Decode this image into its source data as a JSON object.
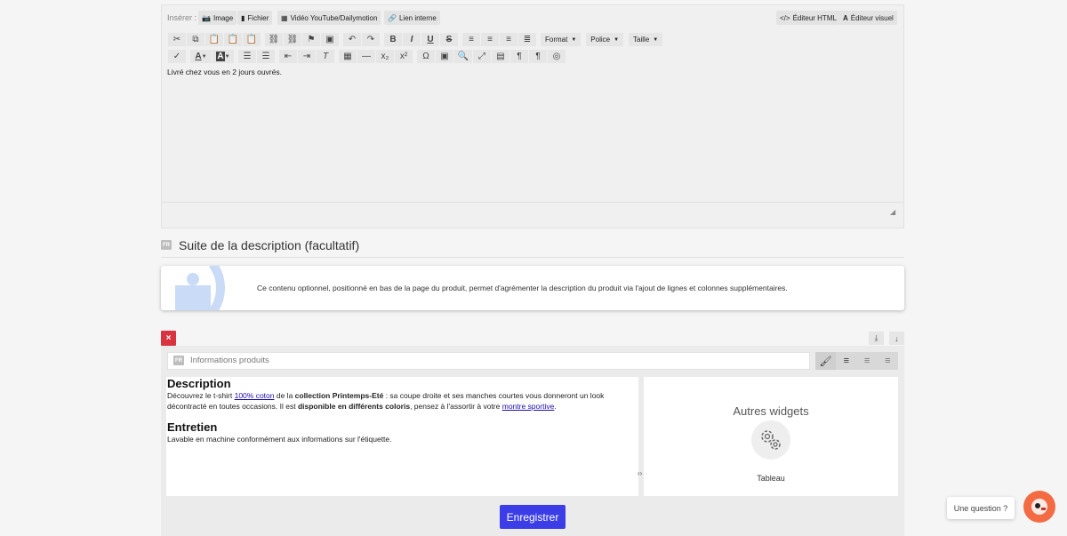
{
  "insert_bar": {
    "label": "Insérer :",
    "buttons": [
      {
        "icon": "camera-icon",
        "label": "Image"
      },
      {
        "icon": "file-icon",
        "label": "Fichier"
      },
      {
        "icon": "film-icon",
        "label": "Vidéo YouTube/Dailymotion"
      },
      {
        "icon": "link-icon",
        "label": "Lien interne"
      }
    ],
    "html_editor": "Éditeur HTML",
    "visual_editor": "Éditeur visuel"
  },
  "toolbar": {
    "format": "Format",
    "font": "Police",
    "size": "Taille"
  },
  "editor_content": "Livré chez vous en 2 jours ouvrés.",
  "section": {
    "lang": "FR",
    "title": "Suite de la description (facultatif)"
  },
  "info_box": {
    "text": "Ce contenu optionnel, positionné en bas de la page du produit, permet d'agrémenter la description du produit via l'ajout de lignes et colonnes supplémentaires."
  },
  "block": {
    "delete_label": "×",
    "lang": "FR",
    "title_value": "Informations produits",
    "left_column": {
      "heading1": "Description",
      "p1_a": "Découvrez le t-shirt ",
      "p1_link1": "100% coton",
      "p1_b": " de la ",
      "p1_bold1": "collection Printemps-Eté",
      "p1_c": " : sa coupe droite et ses manches courtes vous donneront un look décontracté en toutes occasions. Il est ",
      "p1_bold2": "disponible en différents coloris",
      "p1_d": ", pensez à l'assortir à votre ",
      "p1_link2": "montre sportive",
      "p1_e": ".",
      "heading2": "Entretien",
      "p2": "Lavable en machine conformément aux informations sur l'étiquette."
    },
    "right_column": {
      "title": "Autres widgets",
      "widget_label": "Tableau"
    }
  },
  "save_button": "Enregistrer",
  "help": {
    "label": "Une question ?"
  },
  "colors": {
    "save": "#3b3ee6",
    "delete": "#d9333f",
    "help_avatar": "#f36b43"
  }
}
